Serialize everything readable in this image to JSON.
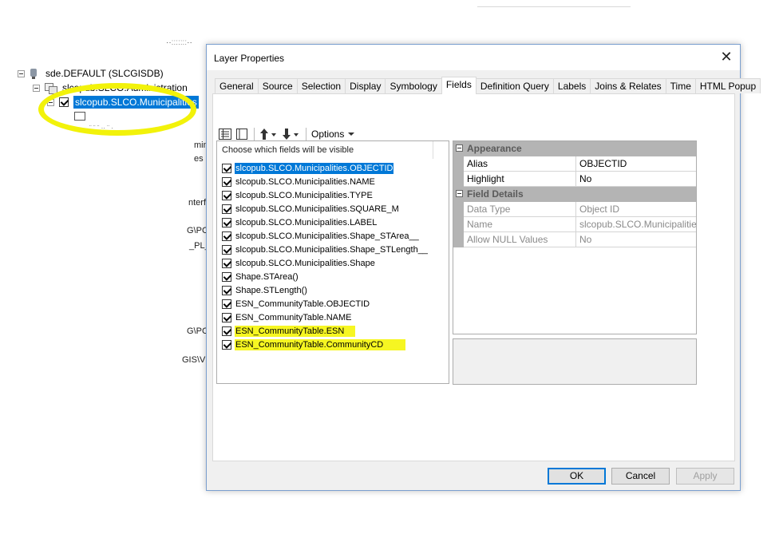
{
  "background": {
    "tree": {
      "connection_label": "sde.DEFAULT (SLCGISDB)",
      "dataset_label": "slcopub.SLCO.Administration",
      "layer_label": "slcopub.SLCO.Municipalities"
    },
    "fragments": [
      "min",
      "es",
      "nterf",
      "G\\PC",
      "_PL_",
      "G\\PC",
      "GIS\\V"
    ]
  },
  "dialog": {
    "title": "Layer Properties",
    "close_glyph": "✕",
    "tabs": [
      {
        "label": "General"
      },
      {
        "label": "Source"
      },
      {
        "label": "Selection"
      },
      {
        "label": "Display"
      },
      {
        "label": "Symbology"
      },
      {
        "label": "Fields"
      },
      {
        "label": "Definition Query"
      },
      {
        "label": "Labels"
      },
      {
        "label": "Joins & Relates"
      },
      {
        "label": "Time"
      },
      {
        "label": "HTML Popup"
      }
    ],
    "active_tab": "Fields",
    "toolbar": {
      "options_label": "Options",
      "icons": [
        "list-view-icon",
        "table-view-icon",
        "move-up-arrow-icon",
        "move-down-arrow-icon"
      ]
    },
    "field_list": {
      "header": "Choose which fields will be visible",
      "fields": [
        {
          "name": "slcopub.SLCO.Municipalities.OBJECTID",
          "checked": true
        },
        {
          "name": "slcopub.SLCO.Municipalities.NAME",
          "checked": true
        },
        {
          "name": "slcopub.SLCO.Municipalities.TYPE",
          "checked": true
        },
        {
          "name": "slcopub.SLCO.Municipalities.SQUARE_M",
          "checked": true
        },
        {
          "name": "slcopub.SLCO.Municipalities.LABEL",
          "checked": true
        },
        {
          "name": "slcopub.SLCO.Municipalities.Shape_STArea__",
          "checked": true
        },
        {
          "name": "slcopub.SLCO.Municipalities.Shape_STLength__",
          "checked": true
        },
        {
          "name": "slcopub.SLCO.Municipalities.Shape",
          "checked": true
        },
        {
          "name": "Shape.STArea()",
          "checked": true
        },
        {
          "name": "Shape.STLength()",
          "checked": true
        },
        {
          "name": "ESN_CommunityTable.OBJECTID",
          "checked": true
        },
        {
          "name": "ESN_CommunityTable.NAME",
          "checked": true
        },
        {
          "name": "ESN_CommunityTable.ESN",
          "checked": true
        },
        {
          "name": "ESN_CommunityTable.CommunityCD",
          "checked": true
        }
      ]
    },
    "property_grid": {
      "appearance_label": "Appearance",
      "alias_name": "Alias",
      "alias_value": "OBJECTID",
      "highlight_name": "Highlight",
      "highlight_value": "No",
      "details_label": "Field Details",
      "datatype_name": "Data Type",
      "datatype_value": "Object ID",
      "name_name": "Name",
      "name_value": "slcopub.SLCO.Municipalities.OBJECTID",
      "nulls_name": "Allow NULL Values",
      "nulls_value": "No"
    },
    "buttons": {
      "ok": "OK",
      "cancel": "Cancel",
      "apply": "Apply"
    }
  },
  "colors": {
    "selection": "#0078d7",
    "highlighter_yellow": "#f2f20a",
    "category_gray": "#b4b4b4"
  }
}
